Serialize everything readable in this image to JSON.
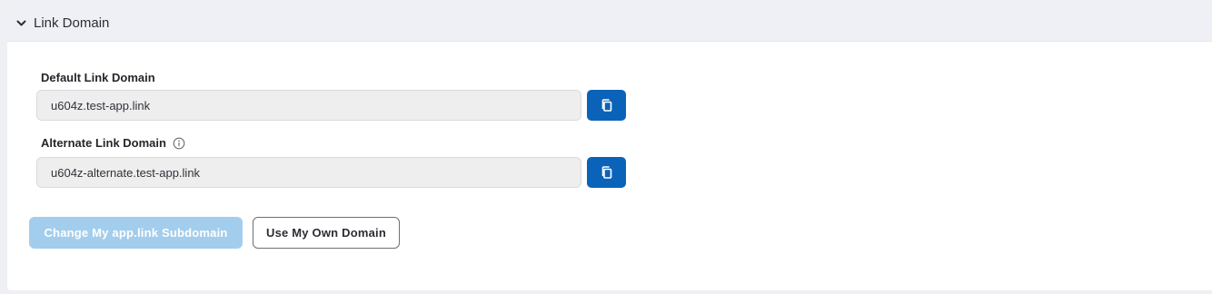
{
  "section": {
    "title": "Link Domain",
    "chevron_icon": "chevron-down-icon"
  },
  "default_domain": {
    "label": "Default Link Domain",
    "value": "u604z.test-app.link",
    "copy_icon": "copy-icon"
  },
  "alternate_domain": {
    "label": "Alternate Link Domain",
    "info_icon": "info-icon",
    "value": "u604z-alternate.test-app.link",
    "copy_icon": "copy-icon"
  },
  "actions": {
    "change_subdomain_label": "Change My app.link Subdomain",
    "use_own_domain_label": "Use My Own Domain"
  },
  "colors": {
    "primary": "#0a63b8",
    "primary_disabled": "#a3cdec",
    "header_bg": "#eef0f5"
  }
}
